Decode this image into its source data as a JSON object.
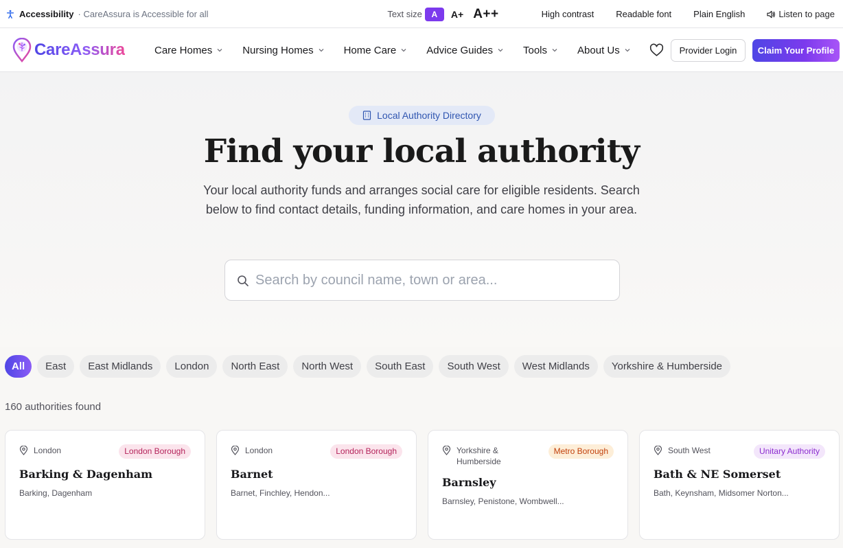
{
  "accessibility": {
    "label": "Accessibility",
    "tagline": "· CareAssura is Accessible for all",
    "text_size_label": "Text size",
    "size_normal": "A",
    "size_large": "A+",
    "size_xlarge": "A++",
    "high_contrast": "High contrast",
    "readable_font": "Readable font",
    "plain_english": "Plain English",
    "listen": "Listen to page"
  },
  "nav": {
    "logo_text": "CareAssura",
    "items": [
      {
        "label": "Care Homes"
      },
      {
        "label": "Nursing Homes"
      },
      {
        "label": "Home Care"
      },
      {
        "label": "Advice Guides"
      },
      {
        "label": "Tools"
      },
      {
        "label": "About Us"
      }
    ],
    "provider_login": "Provider Login",
    "claim_profile": "Claim Your Profile"
  },
  "hero": {
    "badge": "Local Authority Directory",
    "title": "Find your local authority",
    "subtitle": "Your local authority funds and arranges social care for eligible residents. Search below to find contact details, funding information, and care homes in your area.",
    "search_placeholder": "Search by council name, town or area..."
  },
  "regions": [
    "All",
    "East",
    "East Midlands",
    "London",
    "North East",
    "North West",
    "South East",
    "South West",
    "West Midlands",
    "Yorkshire & Humberside"
  ],
  "results": {
    "count_text": "160 authorities found",
    "cards": [
      {
        "region": "London",
        "type": "London Borough",
        "name": "Barking & Dagenham",
        "towns": "Barking, Dagenham"
      },
      {
        "region": "London",
        "type": "London Borough",
        "name": "Barnet",
        "towns": "Barnet, Finchley, Hendon..."
      },
      {
        "region": "Yorkshire & Humberside",
        "type": "Metro Borough",
        "name": "Barnsley",
        "towns": "Barnsley, Penistone, Wombwell..."
      },
      {
        "region": "South West",
        "type": "Unitary Authority",
        "name": "Bath & NE Somerset",
        "towns": "Bath, Keynsham, Midsomer Norton..."
      }
    ]
  },
  "colors": {
    "brand_primary": "#4f46e5",
    "brand_secondary": "#8b5cf6",
    "brand_pink": "#ec4899",
    "badge_bg": "#e3e9f7",
    "badge_text": "#2f55b0"
  }
}
